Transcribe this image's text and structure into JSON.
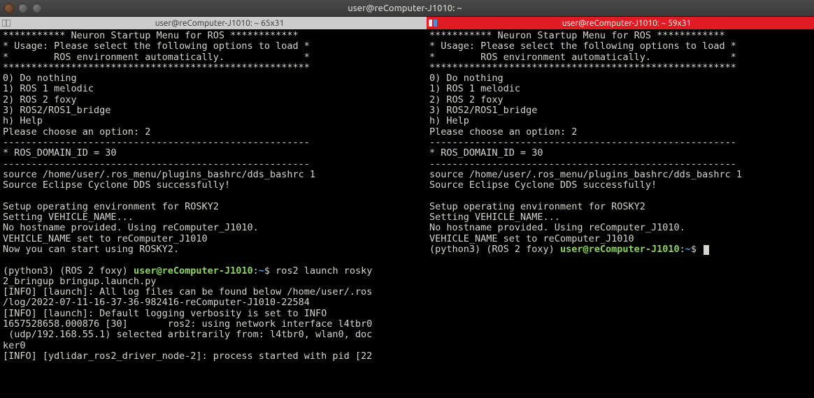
{
  "window": {
    "title": "user@reComputer-J1010: ~"
  },
  "pane_left": {
    "header": "user@reComputer-J1010: ~ 65x31",
    "menu_header_stars": "*********** Neuron Startup Menu for ROS ************",
    "menu_usage": "* Usage: Please select the following options to load *",
    "menu_usage2": "*        ROS environment automatically.              *",
    "menu_footer_stars": "******************************************************",
    "opt0": "0) Do nothing",
    "opt1": "1) ROS 1 melodic",
    "opt2": "2) ROS 2 foxy",
    "opt3": "3) ROS2/ROS1_bridge",
    "opth": "h) Help",
    "choose": "Please choose an option: 2",
    "dash1": "------------------------------------------------------",
    "domain": "* ROS_DOMAIN_ID = 30",
    "dash2": "------------------------------------------------------",
    "source1": "source /home/user/.ros_menu/plugins_bashrc/dds_bashrc 1",
    "source2": "Source Eclipse Cyclone DDS successfully!",
    "setup1": "Setup operating environment for ROSKY2",
    "setup2": "Setting VEHICLE_NAME...",
    "setup3": "No hostname provided. Using reComputer_J1010.",
    "setup4": "VEHICLE_NAME set to reComputer_J1010",
    "setup5": "Now you can start using ROSKY2.",
    "prompt_env": "(python3) (ROS 2 foxy) ",
    "prompt_user": "user@reComputer-J1010",
    "prompt_colon": ":",
    "prompt_path": "~",
    "prompt_dollar": "$ ",
    "cmd": "ros2 launch rosky2_bringup bringup.launch.py",
    "log1": "[INFO] [launch]: All log files can be found below /home/user/.ros/log/2022-07-11-16-37-36-982416-reComputer-J1010-22584",
    "log2": "[INFO] [launch]: Default logging verbosity is set to INFO",
    "log3": "1657528658.000876 [30]       ros2: using network interface l4tbr0 (udp/192.168.55.1) selected arbitrarily from: l4tbr0, wlan0, docker0",
    "log4": "[INFO] [ydlidar_ros2_driver_node-2]: process started with pid [22"
  },
  "pane_right": {
    "header": "user@reComputer-J1010: ~ 59x31",
    "menu_header_stars": "*********** Neuron Startup Menu for ROS ************",
    "menu_usage": "* Usage: Please select the following options to load *",
    "menu_usage2": "*        ROS environment automatically.              *",
    "menu_footer_stars": "******************************************************",
    "opt0": "0) Do nothing",
    "opt1": "1) ROS 1 melodic",
    "opt2": "2) ROS 2 foxy",
    "opt3": "3) ROS2/ROS1_bridge",
    "opth": "h) Help",
    "choose": "Please choose an option: 2",
    "dash1": "------------------------------------------------------",
    "domain": "* ROS_DOMAIN_ID = 30",
    "dash2": "------------------------------------------------------",
    "source1": "source /home/user/.ros_menu/plugins_bashrc/dds_bashrc 1",
    "source2": "Source Eclipse Cyclone DDS successfully!",
    "setup1": "Setup operating environment for ROSKY2",
    "setup2": "Setting VEHICLE_NAME...",
    "setup3": "No hostname provided. Using reComputer_J1010.",
    "setup4": "VEHICLE_NAME set to reComputer_J1010",
    "prompt_env": "(python3) (ROS 2 foxy) ",
    "prompt_user": "user@reComputer-J1010",
    "prompt_colon": ":",
    "prompt_path": "~",
    "prompt_dollar": "$ "
  }
}
